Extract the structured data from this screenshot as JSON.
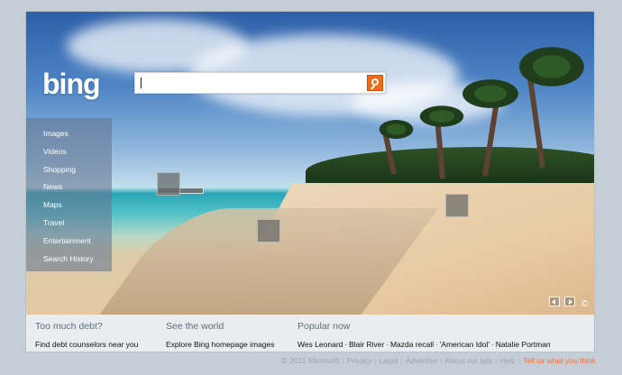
{
  "logo": "bing",
  "search": {
    "value": "",
    "placeholder": ""
  },
  "nav_items": [
    "Images",
    "Videos",
    "Shopping",
    "News",
    "Maps",
    "Travel",
    "Entertainment",
    "Search History"
  ],
  "hero": {
    "copyright_symbol": "©"
  },
  "bottom": {
    "debt": {
      "title": "Too much debt?",
      "link": "Find debt counselors near you"
    },
    "world": {
      "title": "See the world",
      "link": "Explore Bing homepage images"
    },
    "popular": {
      "title": "Popular now",
      "links": [
        "Wes Leonard",
        "Blair River",
        "Mazda recall",
        "'American Idol'",
        "Natalie Portman"
      ]
    }
  },
  "footer": [
    "© 2011 Microsoft",
    "Privacy",
    "Legal",
    "Advertise",
    "About our ads",
    "Help",
    "Tell us what you think"
  ],
  "colors": {
    "accent": "#ef6b17",
    "footer_link": "#ff6b2b"
  }
}
